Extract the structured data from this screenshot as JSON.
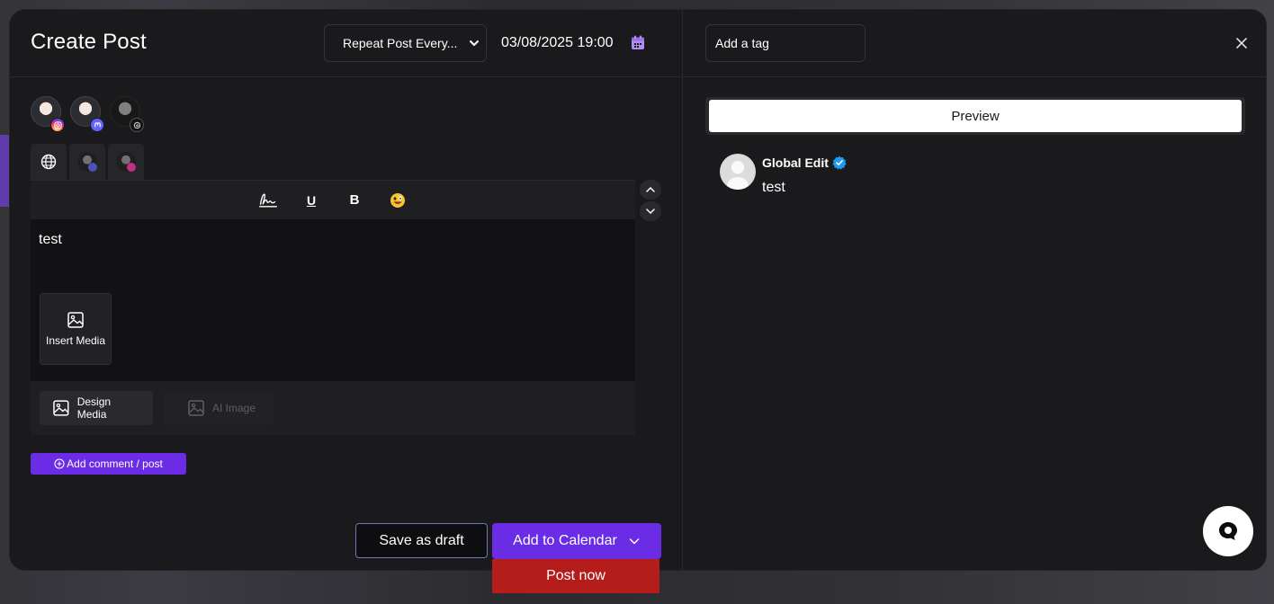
{
  "header": {
    "title": "Create Post",
    "repeat_select": "Repeat Post Every...",
    "datetime": "03/08/2025 19:00"
  },
  "accounts": [
    {
      "platform": "instagram",
      "active": true
    },
    {
      "platform": "mastodon",
      "active": true
    },
    {
      "platform": "threads",
      "active": false
    }
  ],
  "editor": {
    "text": "test",
    "insert_media_label": "Insert Media",
    "design_media_label": "Design Media",
    "ai_image_label": "AI Image"
  },
  "actions": {
    "add_comment_label": "Add comment / post",
    "save_draft_label": "Save as draft",
    "add_calendar_label": "Add to Calendar",
    "post_now_label": "Post now"
  },
  "right_panel": {
    "tag_placeholder": "Add a tag",
    "preview_label": "Preview",
    "preview_name": "Global Edit",
    "preview_text": "test"
  },
  "colors": {
    "accent": "#6b2ce6",
    "danger": "#b51c1c",
    "calendar_icon": "#b28cf0",
    "verified": "#1d9bf0"
  }
}
